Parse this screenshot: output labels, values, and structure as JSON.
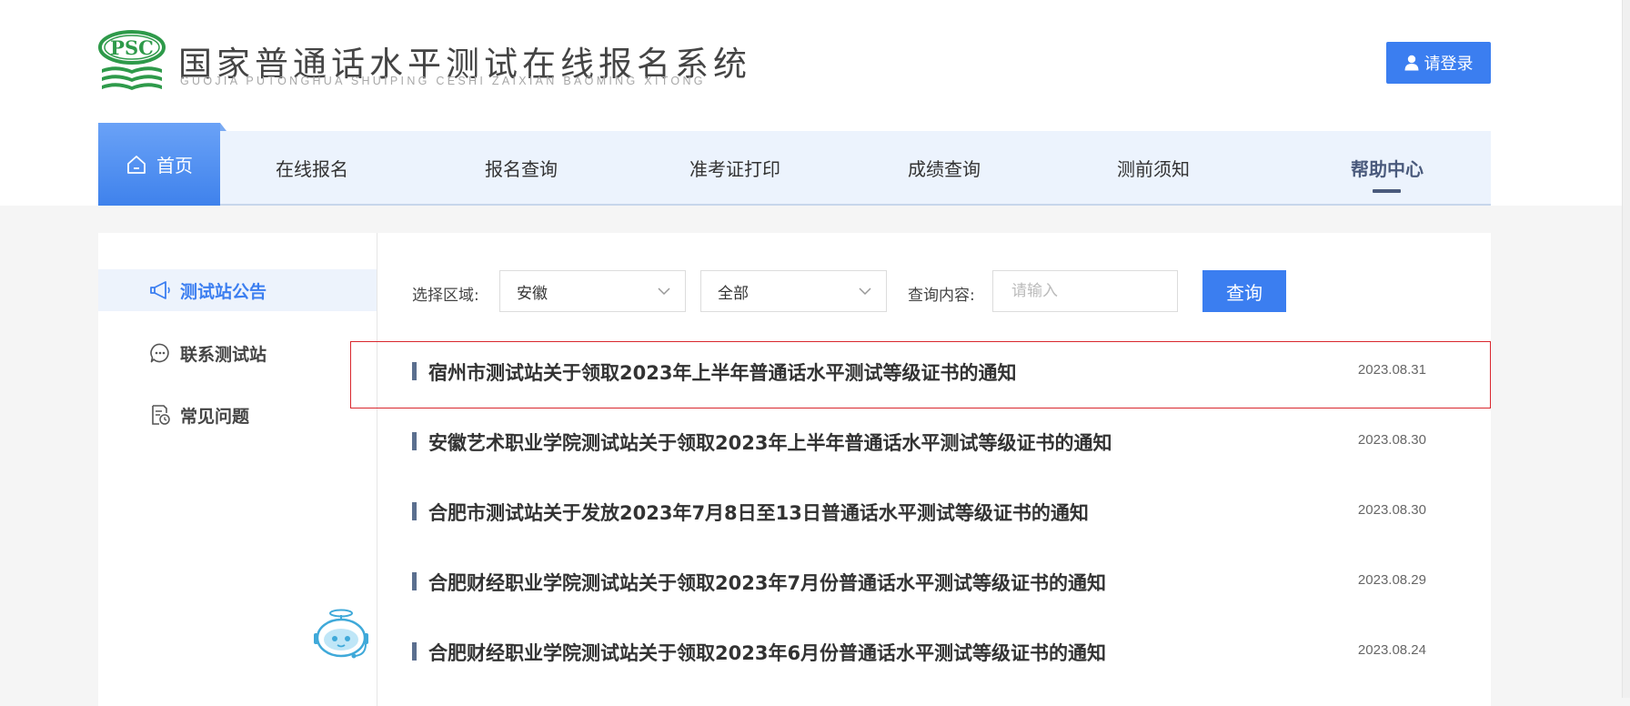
{
  "header": {
    "logo_badge": "PSC",
    "title": "国家普通话水平测试在线报名系统",
    "subtitle": "GUOJIA PUTONGHUA SHUIPING CESHI ZAIXIAN BAOMING XITONG",
    "login_label": "请登录",
    "login_icon": "user-icon"
  },
  "nav": {
    "home": "首页",
    "home_icon": "home-icon",
    "items": [
      "在线报名",
      "报名查询",
      "准考证打印",
      "成绩查询",
      "测前须知",
      "帮助中心"
    ],
    "active_item": "帮助中心"
  },
  "sidebar": {
    "items": [
      {
        "label": "测试站公告",
        "icon": "megaphone-icon",
        "active": true
      },
      {
        "label": "联系测试站",
        "icon": "chat-bubble-icon",
        "active": false
      },
      {
        "label": "常见问题",
        "icon": "document-clock-icon",
        "active": false
      }
    ]
  },
  "filters": {
    "region_label": "选择区域:",
    "region_value": "安徽",
    "category_value": "全部",
    "query_label": "查询内容:",
    "query_placeholder": "请输入",
    "query_button": "查询"
  },
  "notices": [
    {
      "title": "宿州市测试站关于领取2023年上半年普通话水平测试等级证书的通知",
      "date": "2023.08.31",
      "highlighted": true
    },
    {
      "title": "安徽艺术职业学院测试站关于领取2023年上半年普通话水平测试等级证书的通知",
      "date": "2023.08.30",
      "highlighted": false
    },
    {
      "title": "合肥市测试站关于发放2023年7月8日至13日普通话水平测试等级证书的通知",
      "date": "2023.08.30",
      "highlighted": false
    },
    {
      "title": "合肥财经职业学院测试站关于领取2023年7月份普通话水平测试等级证书的通知",
      "date": "2023.08.29",
      "highlighted": false
    },
    {
      "title": "合肥财经职业学院测试站关于领取2023年6月份普通话水平测试等级证书的通知",
      "date": "2023.08.24",
      "highlighted": false
    }
  ],
  "colors": {
    "primary": "#3b7ef0",
    "nav_bg": "#ecf3fd",
    "highlight_border": "#d9272e",
    "logo_green": "#2e9a4a"
  }
}
